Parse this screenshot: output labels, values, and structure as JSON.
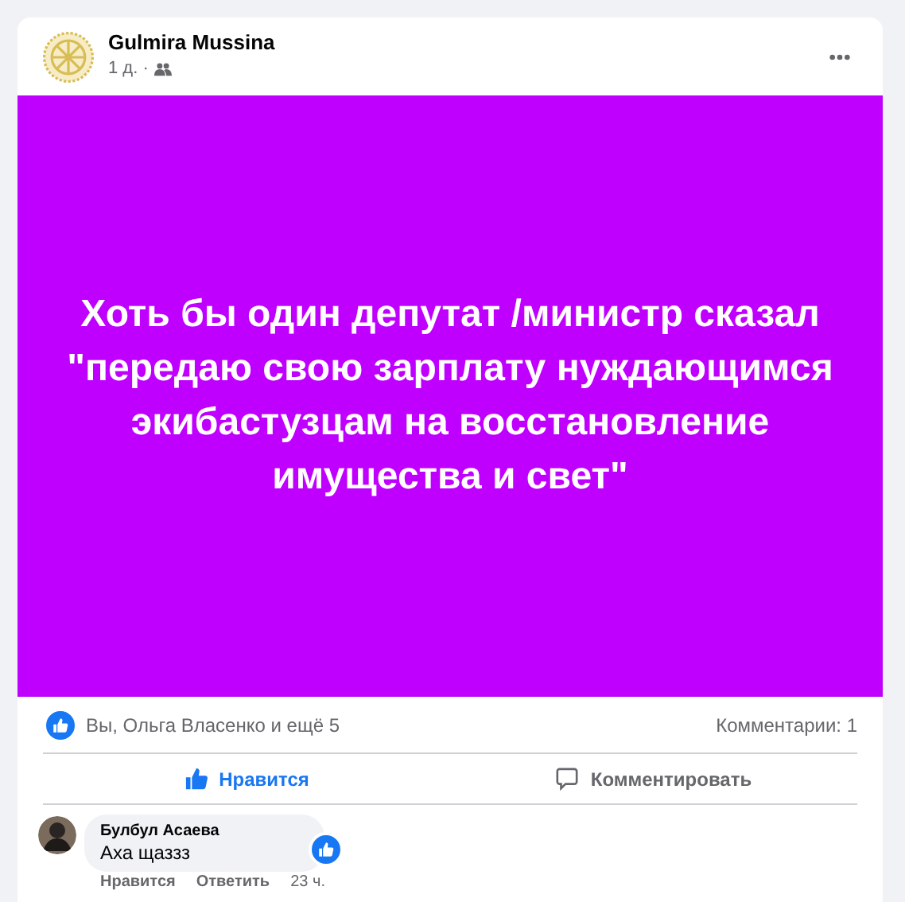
{
  "post": {
    "author": "Gulmira Mussina",
    "time": "1 д. ·",
    "text": "Хоть бы один депутат /министр сказал \"передаю свою зарплату нуждающимся экибастузцам на восстановление имущества и свет\""
  },
  "reactions": {
    "summary": "Вы, Ольга Власенко и ещё 5",
    "comments_count": "Комментарии: 1"
  },
  "actions": [
    {
      "kind": "like",
      "label": "Нравится",
      "selected": true
    },
    {
      "kind": "comment",
      "label": "Комментировать",
      "selected": false
    }
  ],
  "comments": [
    {
      "author": "Булбул Асаева",
      "text": "Аха щаззз",
      "liked": true,
      "actions": [
        "Нравится",
        "Ответить"
      ],
      "time": "23 ч."
    }
  ]
}
